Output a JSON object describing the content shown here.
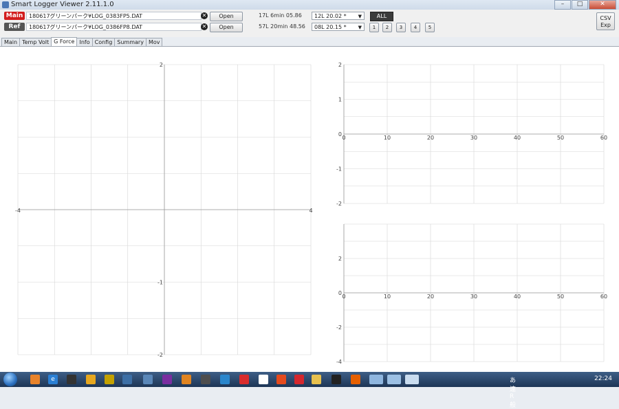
{
  "window": {
    "title": "Smart Logger Viewer 2.11.1.0",
    "minimize": "–",
    "maximize": "□",
    "close": "✕"
  },
  "toolbar": {
    "main_tag": "Main",
    "ref_tag": "Ref",
    "main_file": "180617グリーンパーク¥LOG_0383FP5.DAT",
    "ref_file": "180617グリーンパーク¥LOG_0386FP8.DAT",
    "open_label": "Open",
    "main_info": "17L 6min 05.86",
    "ref_info": "57L 20min 48.56",
    "main_lap": "12L 20.02 *",
    "ref_lap": "08L 20.15 *",
    "all_label": "ALL",
    "slots": [
      "1",
      "2",
      "3",
      "4",
      "5"
    ],
    "csv_label": "CSV Exp"
  },
  "tabs": [
    "Main",
    "Temp Volt",
    "G Force",
    "Info",
    "Config",
    "Summary",
    "Mov"
  ],
  "active_tab": "G Force",
  "colors": {
    "main_series": "#ff0000",
    "ref_series": "#6e6e6e",
    "grid": "#d6d6d6",
    "axis": "#999999"
  },
  "chart_data": [
    {
      "type": "scatter",
      "series": [],
      "x_range": [
        -4,
        4
      ],
      "y_range": [
        -2,
        2
      ],
      "x_ticks": [
        "-4",
        "4"
      ],
      "y_ticks": [
        "2",
        "-1",
        "-2"
      ],
      "grid": true
    },
    {
      "type": "scatter",
      "series": [],
      "x_range": [
        0,
        60
      ],
      "y_range": [
        -2,
        2
      ],
      "x_ticks": [
        "0",
        "10",
        "20",
        "30",
        "40",
        "50",
        "60"
      ],
      "y_ticks": [
        "2",
        "1",
        "0",
        "-1",
        "-2"
      ],
      "grid": true
    },
    {
      "type": "scatter",
      "series": [],
      "x_range": [
        0,
        60
      ],
      "y_range": [
        -4,
        4
      ],
      "x_ticks": [
        "0",
        "10",
        "20",
        "30",
        "40",
        "50",
        "60"
      ],
      "y_ticks": [
        "2",
        "0",
        "-2",
        "-4"
      ],
      "grid": true
    }
  ],
  "taskbar": {
    "clock": "22:24",
    "ime": "あ 連 R 般"
  }
}
